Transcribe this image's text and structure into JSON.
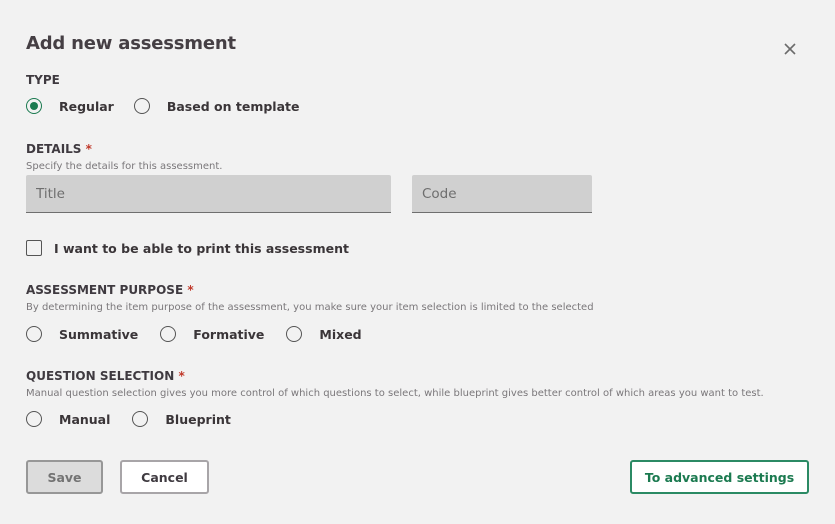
{
  "dialog": {
    "title": "Add new assessment",
    "close_icon": "close-icon"
  },
  "type": {
    "label": "TYPE",
    "options": [
      {
        "label": "Regular",
        "checked": true
      },
      {
        "label": "Based on template",
        "checked": false
      }
    ]
  },
  "details": {
    "label": "DETAILS",
    "required_mark": "*",
    "hint": "Specify the details for this assessment.",
    "title_placeholder": "Title",
    "title_value": "",
    "code_placeholder": "Code",
    "code_value": ""
  },
  "print_option": {
    "label": "I want to be able to print this assessment",
    "checked": false
  },
  "purpose": {
    "label": "ASSESSMENT PURPOSE",
    "required_mark": "*",
    "hint": "By determining the item purpose of the assessment, you make sure your item selection is limited to the selected",
    "options": [
      {
        "label": "Summative",
        "checked": false
      },
      {
        "label": "Formative",
        "checked": false
      },
      {
        "label": "Mixed",
        "checked": false
      }
    ]
  },
  "question_selection": {
    "label": "QUESTION SELECTION",
    "required_mark": "*",
    "hint": "Manual question selection gives you more control of which questions to select, while blueprint gives better control of which areas you want to test.",
    "options": [
      {
        "label": "Manual",
        "checked": false
      },
      {
        "label": "Blueprint",
        "checked": false
      }
    ]
  },
  "footer": {
    "save_label": "Save",
    "cancel_label": "Cancel",
    "advanced_label": "To advanced settings"
  },
  "colors": {
    "accent": "#1b7a50",
    "required": "#c0392b",
    "background": "#f2f2f2"
  }
}
